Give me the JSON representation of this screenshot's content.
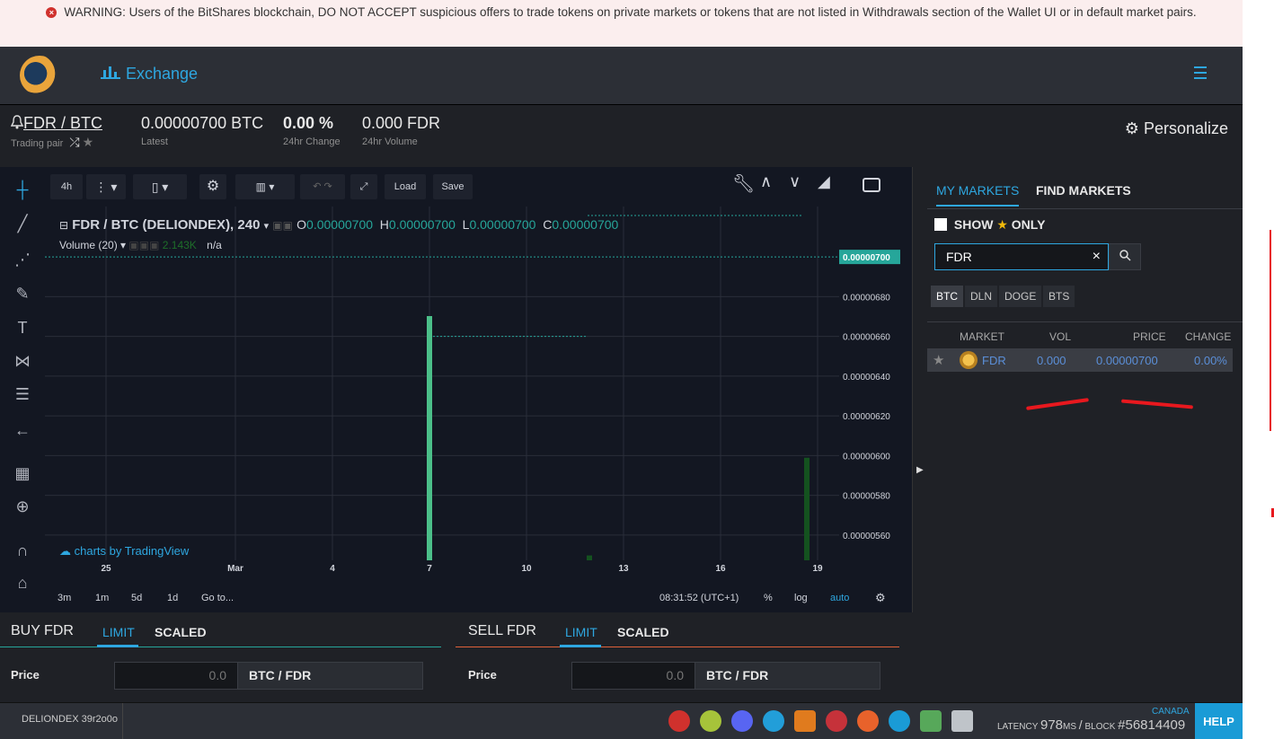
{
  "warning": "WARNING: Users of the BitShares blockchain, DO NOT ACCEPT suspicious offers to trade tokens on private markets or tokens that are not listed in Withdrawals section of the Wallet UI or in default market pairs.",
  "header": {
    "nav_label": "Exchange"
  },
  "pair": {
    "name": "FDR / BTC",
    "name_sub": "Trading pair",
    "latest": "0.00000700 BTC",
    "latest_sub": "Latest",
    "change": "0.00 %",
    "change_sub": "24hr Change",
    "volume": "0.000 FDR",
    "volume_sub": "24hr Volume",
    "personalize": "Personalize"
  },
  "chart_toolbar": {
    "interval": "4h",
    "load": "Load",
    "save": "Save"
  },
  "chart_legend": {
    "symbol": "FDR / BTC (DELIONDEX), 240",
    "o_label": "O",
    "o_val": "0.00000700",
    "h_label": "H",
    "h_val": "0.00000700",
    "l_label": "L",
    "l_val": "0.00000700",
    "c_label": "C",
    "c_val": "0.00000700",
    "volume_label": "Volume (20)",
    "volume_val": "2.143K",
    "volume_na": "n/a",
    "watermark": "charts by TradingView"
  },
  "chart_data": {
    "type": "bar",
    "title": "FDR / BTC (DELIONDEX), 240",
    "x_ticks": [
      "25",
      "Mar",
      "4",
      "7",
      "10",
      "13",
      "16",
      "19"
    ],
    "y_ticks": [
      "0.00000680",
      "0.00000660",
      "0.00000640",
      "0.00000620",
      "0.00000600",
      "0.00000580",
      "0.00000560"
    ],
    "current_price": "0.00000700",
    "ylim": [
      5.5e-06,
      7.1e-06
    ],
    "volume_bars": [
      {
        "x": "7",
        "value": 1.0
      },
      {
        "x": "12",
        "value": 0.02
      },
      {
        "x": "19",
        "value": 0.42
      }
    ]
  },
  "chart_bottom": {
    "ranges": [
      "3m",
      "1m",
      "5d",
      "1d",
      "Go to..."
    ],
    "time": "08:31:52 (UTC+1)",
    "pct": "%",
    "log": "log",
    "auto": "auto"
  },
  "markets": {
    "tab_my": "MY MARKETS",
    "tab_find": "FIND MARKETS",
    "show": "SHOW",
    "only": "ONLY",
    "search_value": "FDR",
    "coins": [
      "BTC",
      "DLN",
      "DOGE",
      "BTS"
    ],
    "headers": {
      "market": "MARKET",
      "vol": "VOL",
      "price": "PRICE",
      "change": "CHANGE"
    },
    "row": {
      "market": "FDR",
      "vol": "0.000",
      "price": "0.00000700",
      "change": "0.00%"
    }
  },
  "buy": {
    "title": "BUY FDR",
    "tab_limit": "LIMIT",
    "tab_scaled": "SCALED",
    "price_label": "Price",
    "price_placeholder": "0.0",
    "unit": "BTC / FDR"
  },
  "sell": {
    "title": "SELL FDR",
    "tab_limit": "LIMIT",
    "tab_scaled": "SCALED",
    "price_label": "Price",
    "price_placeholder": "0.0",
    "unit": "BTC / FDR"
  },
  "footer": {
    "node": "DELIONDEX 39r2o0o",
    "region": "CANADA",
    "latency_label": "LATENCY",
    "latency_val": "978",
    "latency_unit": "MS",
    "block_label": "BLOCK",
    "block_val": "#56814409",
    "help": "HELP"
  },
  "colors": {
    "accent": "#2ea7e0",
    "up": "#26a69a",
    "bg": "#1f2126"
  }
}
